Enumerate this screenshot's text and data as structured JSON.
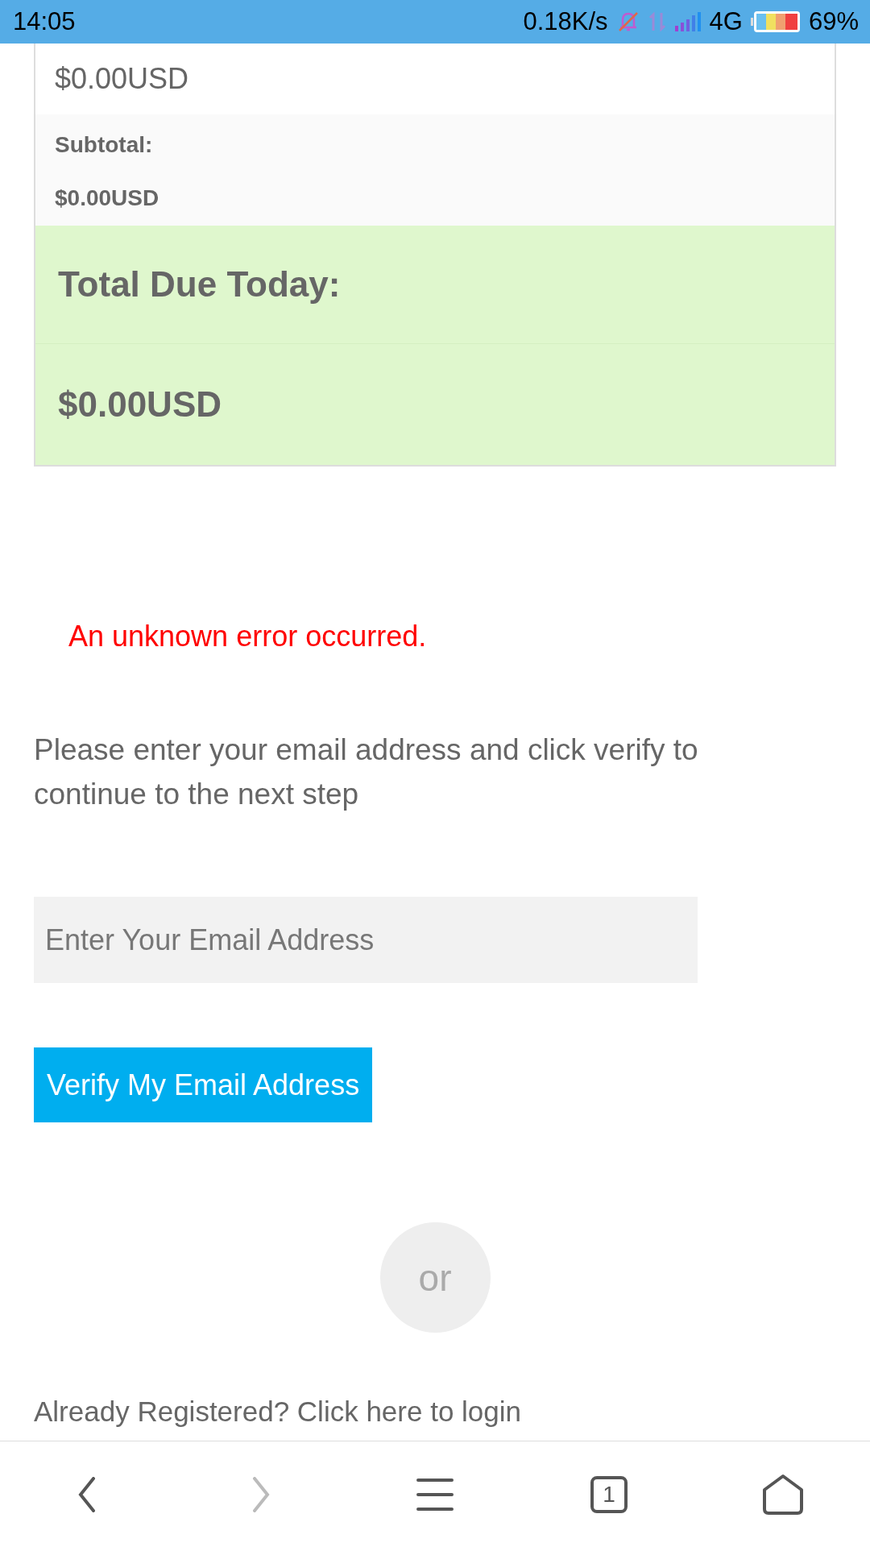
{
  "status_bar": {
    "time": "14:05",
    "speed": "0.18K/s",
    "network": "4G",
    "battery": "69%"
  },
  "summary": {
    "rows": [
      {
        "kind": "plain",
        "text": "$0.00USD"
      },
      {
        "kind": "subtotal",
        "label": "Subtotal:",
        "value": "$0.00USD"
      },
      {
        "kind": "total",
        "label": "Total Due Today:",
        "value": "$0.00USD"
      }
    ]
  },
  "error": "An unknown error occurred.",
  "instructions": "Please enter your email address and click verify to continue to the next step",
  "email_field": {
    "placeholder": "Enter Your Email Address"
  },
  "verify_button": "Verify My Email Address",
  "divider": "or",
  "login_link": "Already Registered? Click here to login",
  "nav_bar": [
    {
      "kind": "back",
      "disabled": false
    },
    {
      "kind": "forward",
      "disabled": true
    },
    {
      "kind": "menu",
      "disabled": false
    },
    {
      "kind": "tabs",
      "count": "1",
      "disabled": false
    },
    {
      "kind": "home",
      "disabled": false
    }
  ]
}
